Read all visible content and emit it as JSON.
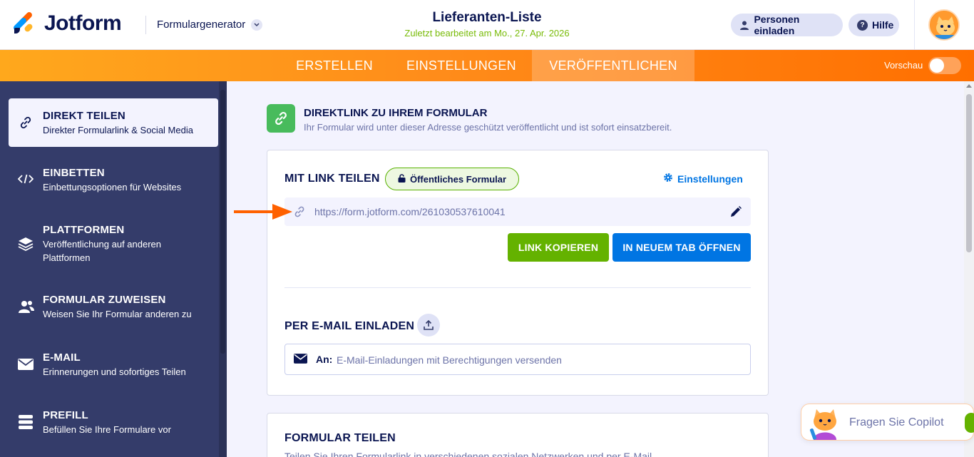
{
  "header": {
    "logo_text": "Jotform",
    "generator_label": "Formulargenerator",
    "form_title": "Lieferanten-Liste",
    "last_edited": "Zuletzt bearbeitet am Mo., 27. Apr. 2026",
    "invite_label": "Personen einladen",
    "help_label": "Hilfe"
  },
  "nav": {
    "tabs": [
      {
        "label": "ERSTELLEN"
      },
      {
        "label": "EINSTELLUNGEN"
      },
      {
        "label": "VERÖFFENTLICHEN"
      }
    ],
    "preview_label": "Vorschau"
  },
  "sidebar": {
    "items": [
      {
        "title": "DIREKT TEILEN",
        "desc": "Direkter Formularlink & Social Media",
        "icon": "link-icon"
      },
      {
        "title": "EINBETTEN",
        "desc": "Einbettungsoptionen für Websites",
        "icon": "code-icon"
      },
      {
        "title": "PLATTFORMEN",
        "desc": "Veröffentlichung auf anderen Plattformen",
        "icon": "layers-icon"
      },
      {
        "title": "FORMULAR ZUWEISEN",
        "desc": "Weisen Sie Ihr Formular anderen zu",
        "icon": "users-icon"
      },
      {
        "title": "E-MAIL",
        "desc": "Erinnerungen und sofortiges Teilen",
        "icon": "envelope-icon"
      },
      {
        "title": "PREFILL",
        "desc": "Befüllen Sie Ihre Formulare vor",
        "icon": "database-icon"
      }
    ]
  },
  "main": {
    "section_title": "DIREKTLINK ZU IHREM FORMULAR",
    "section_desc": "Ihr Formular wird unter dieser Adresse geschützt veröffentlicht und ist sofort einsatzbereit.",
    "share_title": "MIT LINK TEILEN",
    "public_badge": "Öffentliches Formular",
    "settings_link": "Einstellungen",
    "form_url": "https://form.jotform.com/261030537610041",
    "copy_button": "LINK KOPIEREN",
    "open_button": "IN NEUEM TAB ÖFFNEN",
    "email_title": "PER E-MAIL EINLADEN",
    "email_prefix": "An:",
    "email_placeholder": "E-Mail-Einladungen mit Berechtigungen versenden",
    "share_form_title": "FORMULAR TEILEN",
    "share_form_desc": "Teilen Sie Ihren Formularlink in verschiedenen sozialen Netzwerken und per E-Mail."
  },
  "copilot": {
    "label": "Fragen Sie Copilot"
  },
  "colors": {
    "brand_orange": "#ff6100",
    "nav_dark": "#343c6a",
    "success_green": "#64b200",
    "primary_blue": "#0075e3",
    "text_navy": "#0a1551"
  }
}
